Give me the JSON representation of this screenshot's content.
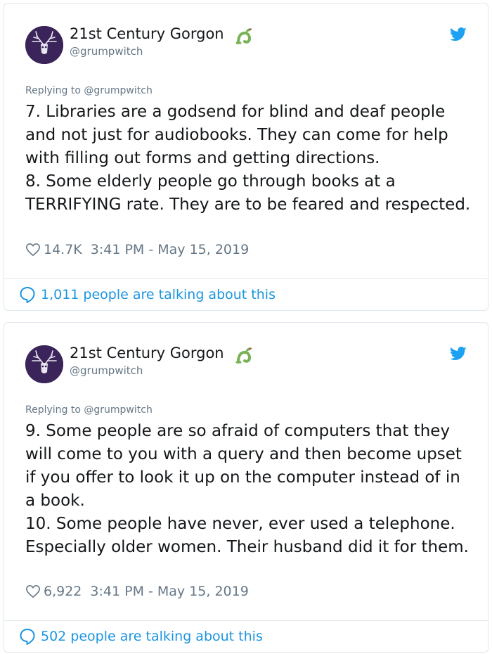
{
  "tweets": [
    {
      "author_name": "21st Century Gorgon",
      "handle": "@grumpwitch",
      "badge_icon": "dragon-emoji",
      "replying_to": "Replying to @grumpwitch",
      "lines": [
        "7. Libraries are a godsend for blind and deaf people and not just for audiobooks. They can come for help with filling out forms and getting directions.",
        "8. Some elderly people go through books at a TERRIFYING rate. They are to be feared and respected."
      ],
      "likes": "14.7K",
      "timestamp": "3:41 PM - May 15, 2019",
      "talking": "1,011 people are talking about this"
    },
    {
      "author_name": "21st Century Gorgon",
      "handle": "@grumpwitch",
      "badge_icon": "dragon-emoji",
      "replying_to": "Replying to @grumpwitch",
      "lines": [
        "9. Some people are so afraid of computers that they will come to you with a query and then become upset if you offer to look it up on the computer instead of in a book.",
        "10. Some people have never, ever used a telephone. Especially older women. Their husband did it for them."
      ],
      "likes": "6,922",
      "timestamp": "3:41 PM - May 15, 2019",
      "talking": "502 people are talking about this"
    }
  ],
  "colors": {
    "link_blue": "#1b95e0",
    "muted_gray": "#657786",
    "text": "#14171a",
    "border": "#e1e8ed",
    "twitter_blue": "#1da1f2",
    "avatar_bg": "#3a2459",
    "dragon_green": "#77b255"
  }
}
